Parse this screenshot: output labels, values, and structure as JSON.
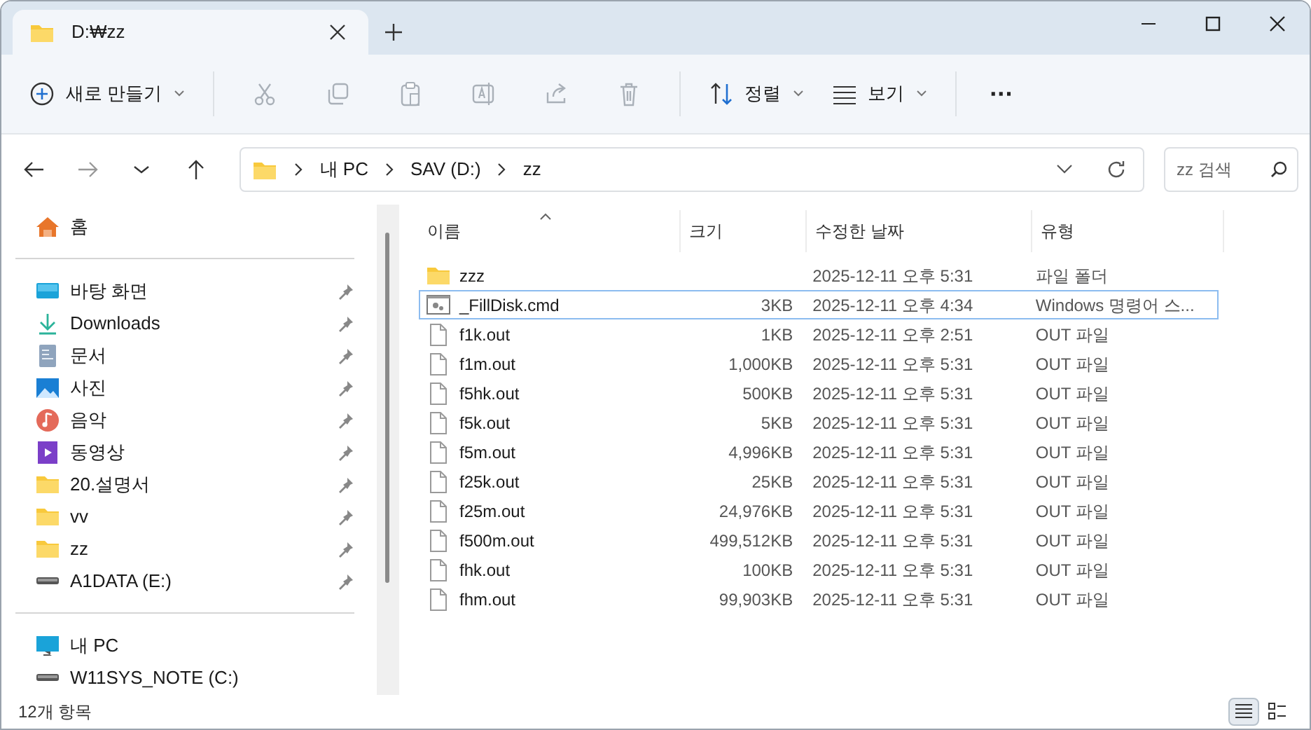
{
  "window": {
    "tabs": [
      {
        "title": "D:₩zz",
        "selected": true
      }
    ]
  },
  "toolbar": [
    {
      "kind": "new",
      "label": "새로 만들기",
      "disabled": false
    },
    {
      "kind": "cut",
      "disabled": true
    },
    {
      "kind": "copy",
      "disabled": true
    },
    {
      "kind": "paste",
      "disabled": true
    },
    {
      "kind": "rename",
      "disabled": true
    },
    {
      "kind": "share",
      "disabled": true
    },
    {
      "kind": "delete",
      "disabled": true
    },
    {
      "kind": "sort",
      "label": "정렬",
      "disabled": false
    },
    {
      "kind": "view",
      "label": "보기",
      "disabled": false
    },
    {
      "kind": "more",
      "label": "···",
      "disabled": false
    }
  ],
  "address": {
    "path": [
      "내 PC",
      "SAV (D:)",
      "zz"
    ],
    "search_placeholder": "zz 검색"
  },
  "sidebar": {
    "groups": [
      [
        {
          "label": "홈",
          "kind": "home",
          "pinned": false
        }
      ],
      [
        {
          "label": "바탕 화면",
          "kind": "desktop",
          "pinned": true
        },
        {
          "label": "Downloads",
          "kind": "downloads",
          "pinned": true
        },
        {
          "label": "문서",
          "kind": "documents",
          "pinned": true
        },
        {
          "label": "사진",
          "kind": "pictures",
          "pinned": true
        },
        {
          "label": "음악",
          "kind": "music",
          "pinned": true
        },
        {
          "label": "동영상",
          "kind": "videos",
          "pinned": true
        },
        {
          "label": "20.설명서",
          "kind": "folder",
          "pinned": true
        },
        {
          "label": "vv",
          "kind": "folder",
          "pinned": true
        },
        {
          "label": "zz",
          "kind": "folder",
          "pinned": true
        },
        {
          "label": "A1DATA (E:)",
          "kind": "drive",
          "pinned": true
        }
      ],
      [
        {
          "label": "내 PC",
          "kind": "pc",
          "pinned": false
        },
        {
          "label": "W11SYS_NOTE (C:)",
          "kind": "drive",
          "pinned": false
        }
      ]
    ]
  },
  "file_list": {
    "columns": [
      "이름",
      "크기",
      "수정한 날짜",
      "유형"
    ],
    "rows": [
      {
        "kind": "folder",
        "name": "zzz",
        "size": "",
        "date": "2025-12-11 오후 5:31",
        "type": "파일 폴더",
        "focused": false
      },
      {
        "kind": "cmd",
        "name": "_FillDisk.cmd",
        "size": "3KB",
        "date": "2025-12-11 오후 4:34",
        "type": "Windows 명령어 스...",
        "focused": true
      },
      {
        "kind": "file",
        "name": "f1k.out",
        "size": "1KB",
        "date": "2025-12-11 오후 2:51",
        "type": "OUT 파일",
        "focused": false
      },
      {
        "kind": "file",
        "name": "f1m.out",
        "size": "1,000KB",
        "date": "2025-12-11 오후 5:31",
        "type": "OUT 파일",
        "focused": false
      },
      {
        "kind": "file",
        "name": "f5hk.out",
        "size": "500KB",
        "date": "2025-12-11 오후 5:31",
        "type": "OUT 파일",
        "focused": false
      },
      {
        "kind": "file",
        "name": "f5k.out",
        "size": "5KB",
        "date": "2025-12-11 오후 5:31",
        "type": "OUT 파일",
        "focused": false
      },
      {
        "kind": "file",
        "name": "f5m.out",
        "size": "4,996KB",
        "date": "2025-12-11 오후 5:31",
        "type": "OUT 파일",
        "focused": false
      },
      {
        "kind": "file",
        "name": "f25k.out",
        "size": "25KB",
        "date": "2025-12-11 오후 5:31",
        "type": "OUT 파일",
        "focused": false
      },
      {
        "kind": "file",
        "name": "f25m.out",
        "size": "24,976KB",
        "date": "2025-12-11 오후 5:31",
        "type": "OUT 파일",
        "focused": false
      },
      {
        "kind": "file",
        "name": "f500m.out",
        "size": "499,512KB",
        "date": "2025-12-11 오후 5:31",
        "type": "OUT 파일",
        "focused": false
      },
      {
        "kind": "file",
        "name": "fhk.out",
        "size": "100KB",
        "date": "2025-12-11 오후 5:31",
        "type": "OUT 파일",
        "focused": false
      },
      {
        "kind": "file",
        "name": "fhm.out",
        "size": "99,903KB",
        "date": "2025-12-11 오후 5:31",
        "type": "OUT 파일",
        "focused": false
      }
    ]
  },
  "status_bar": {
    "text": "12개 항목",
    "views": [
      {
        "kind": "details",
        "selected": true
      },
      {
        "kind": "tiles",
        "selected": false
      }
    ]
  }
}
